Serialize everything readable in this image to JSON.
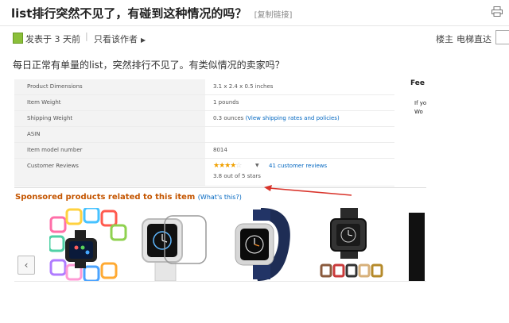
{
  "header": {
    "title": "list排行突然不见了，有碰到这种情况的吗？",
    "copy_link": "[复制链接]",
    "print_icon": "printer-icon"
  },
  "meta": {
    "posted": "发表于 3 天前",
    "author_only": "只看该作者",
    "floor": "楼主",
    "jump": "电梯直达"
  },
  "post": {
    "question": "每日正常有单量的list，突然排行不见了。有类似情况的卖家吗？"
  },
  "product_details": {
    "rows": [
      {
        "label": "Product Dimensions",
        "value": "3.1 x 2.4 x 0.5 inches"
      },
      {
        "label": "Item Weight",
        "value": "1 pounds"
      },
      {
        "label": "Shipping Weight",
        "value": "0.3 ounces",
        "link": "(View shipping rates and policies)"
      },
      {
        "label": "ASIN",
        "value": ""
      },
      {
        "label": "Item model number",
        "value": "8014"
      }
    ],
    "reviews": {
      "label": "Customer Reviews",
      "rating": 3.8,
      "count_link": "41 customer reviews",
      "rating_text": "3.8 out of 5 stars"
    }
  },
  "side_fragment": {
    "heading": "Fee",
    "line1": "If yo",
    "line2": "Wo"
  },
  "sponsored": {
    "title": "Sponsored products related to this item",
    "whats_this": "(What's this?)"
  },
  "colors": {
    "link": "#0066c0",
    "sponsored": "#c45500",
    "star": "#f0a000",
    "arrow": "#d9342b"
  }
}
